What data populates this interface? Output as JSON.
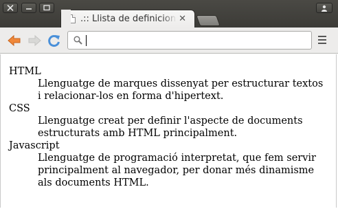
{
  "window": {
    "tab_title": ".:: Llista de definicions",
    "tab_close_label": "✕"
  },
  "toolbar": {
    "address_value": "",
    "icons": [
      "back-arrow-icon",
      "forward-arrow-icon",
      "reload-icon",
      "search-icon",
      "menu-icon"
    ]
  },
  "colors": {
    "titlebar": "#3c3b37",
    "toolbar": "#edeceb",
    "back_arrow": "#f0883a",
    "reload": "#4a90d9"
  },
  "definitions": [
    {
      "term": "HTML",
      "description": "Llenguatge de marques dissenyat per estructurar textos i relacionar-los en forma d'hipertext."
    },
    {
      "term": "CSS",
      "description": "Llenguatge creat per definir l'aspecte de documents estructurats amb HTML principalment."
    },
    {
      "term": "Javascript",
      "description": "Llenguatge de programació interpretat, que fem servir principalment al navegador, per donar més dinamisme als documents HTML."
    }
  ]
}
